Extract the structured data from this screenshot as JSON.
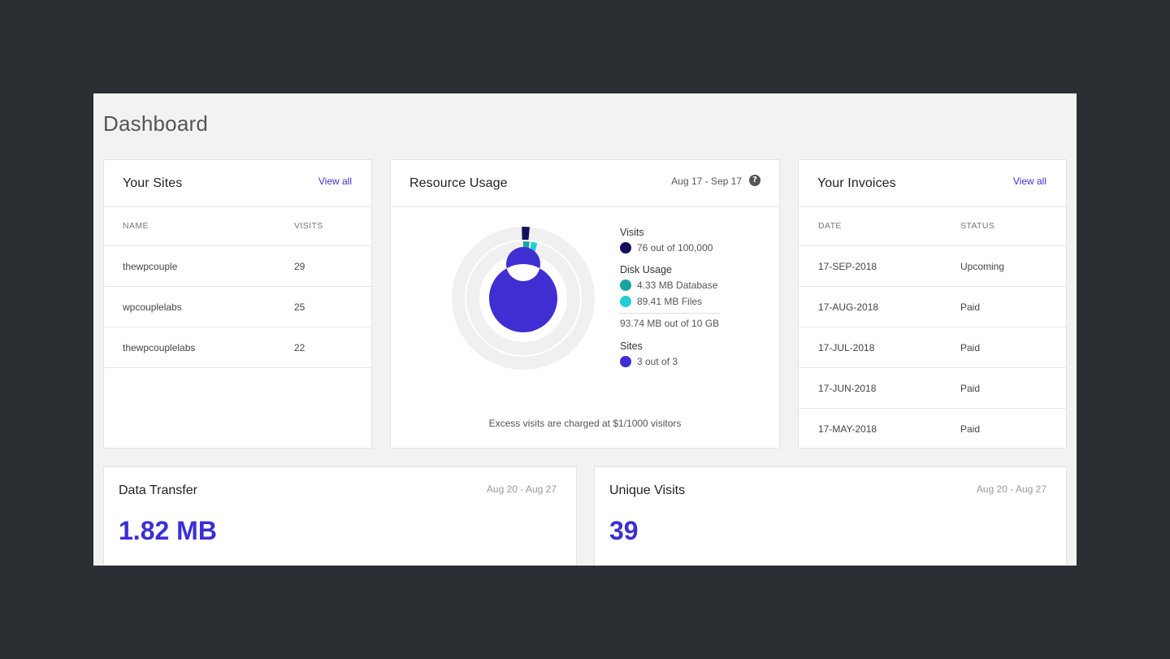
{
  "page": {
    "title": "Dashboard"
  },
  "colors": {
    "accent": "#3a2fd6",
    "visits": "#13105e",
    "database": "#1aa3a3",
    "files": "#25cdd6",
    "sites": "#3f2ed1",
    "track": "#f0f0f0"
  },
  "sites": {
    "title": "Your Sites",
    "view_all": "View all",
    "columns": [
      "NAME",
      "VISITS"
    ],
    "rows": [
      {
        "name": "thewpcouple",
        "visits": "29"
      },
      {
        "name": "wpcouplelabs",
        "visits": "25"
      },
      {
        "name": "thewpcouplelabs",
        "visits": "22"
      }
    ]
  },
  "resource": {
    "title": "Resource Usage",
    "date_range": "Aug 17 - Sep 17",
    "help_icon": "question-circle-icon",
    "visits": {
      "label": "Visits",
      "text": "76 out of 100,000",
      "used": 76,
      "limit": 100000
    },
    "disk": {
      "label": "Disk Usage",
      "database": "4.33 MB Database",
      "files": "89.41 MB Files",
      "total": "93.74 MB out of 10 GB",
      "database_mb": 4.33,
      "files_mb": 89.41,
      "limit_mb": 10240
    },
    "sites": {
      "label": "Sites",
      "text": "3 out of 3",
      "used": 3,
      "limit": 3
    },
    "note": "Excess visits are charged at $1/1000 visitors"
  },
  "invoices": {
    "title": "Your Invoices",
    "view_all": "View all",
    "columns": [
      "DATE",
      "STATUS"
    ],
    "rows": [
      {
        "date": "17-SEP-2018",
        "status": "Upcoming"
      },
      {
        "date": "17-AUG-2018",
        "status": "Paid"
      },
      {
        "date": "17-JUL-2018",
        "status": "Paid"
      },
      {
        "date": "17-JUN-2018",
        "status": "Paid"
      },
      {
        "date": "17-MAY-2018",
        "status": "Paid"
      }
    ]
  },
  "data_transfer": {
    "title": "Data Transfer",
    "date_range": "Aug 20 - Aug 27",
    "value": "1.82 MB"
  },
  "unique_visits": {
    "title": "Unique Visits",
    "date_range": "Aug 20 - Aug 27",
    "value": "39"
  }
}
